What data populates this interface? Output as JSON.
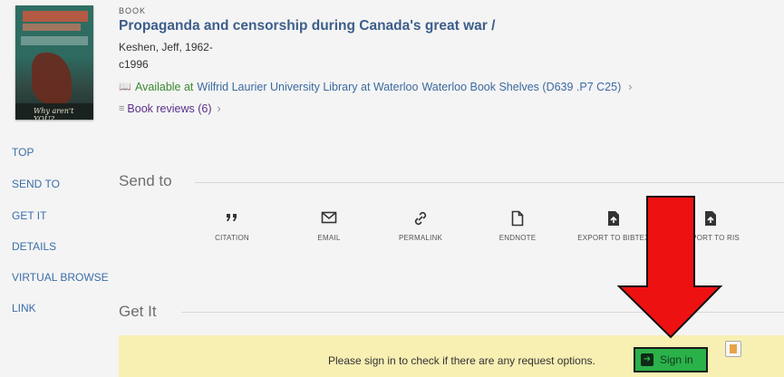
{
  "record": {
    "type": "BOOK",
    "title": "Propaganda and censorship during Canada's great war /",
    "author": "Keshen, Jeff, 1962-",
    "date": "c1996",
    "availability": {
      "status": "Available at",
      "library": "Wilfrid Laurier University Library at Waterloo",
      "shelf": "Waterloo Book Shelves (D639 .P7 C25)"
    },
    "reviews_label": "Book reviews (6)",
    "cover_caption": "Why aren't YOU?"
  },
  "nav": {
    "items": [
      "TOP",
      "SEND TO",
      "GET IT",
      "DETAILS",
      "VIRTUAL BROWSE",
      "LINK"
    ]
  },
  "send_to": {
    "heading": "Send to",
    "actions": [
      {
        "label": "CITATION",
        "icon": "quote-icon"
      },
      {
        "label": "EMAIL",
        "icon": "envelope-icon"
      },
      {
        "label": "PERMALINK",
        "icon": "link-icon"
      },
      {
        "label": "ENDNOTE",
        "icon": "document-icon"
      },
      {
        "label": "EXPORT TO BIBTEX",
        "icon": "export-file-icon"
      },
      {
        "label": "EXPORT TO RIS",
        "icon": "export-file-icon"
      }
    ]
  },
  "get_it": {
    "heading": "Get It",
    "message": "Please sign in to check if there are any request options.",
    "signin_label": "Sign in"
  },
  "colors": {
    "link_blue": "#3b6ea8",
    "available_green": "#3b8a33",
    "signin_green": "#2bb14a",
    "notice_yellow": "#f8efb3",
    "annotation_red": "#ee1111"
  }
}
